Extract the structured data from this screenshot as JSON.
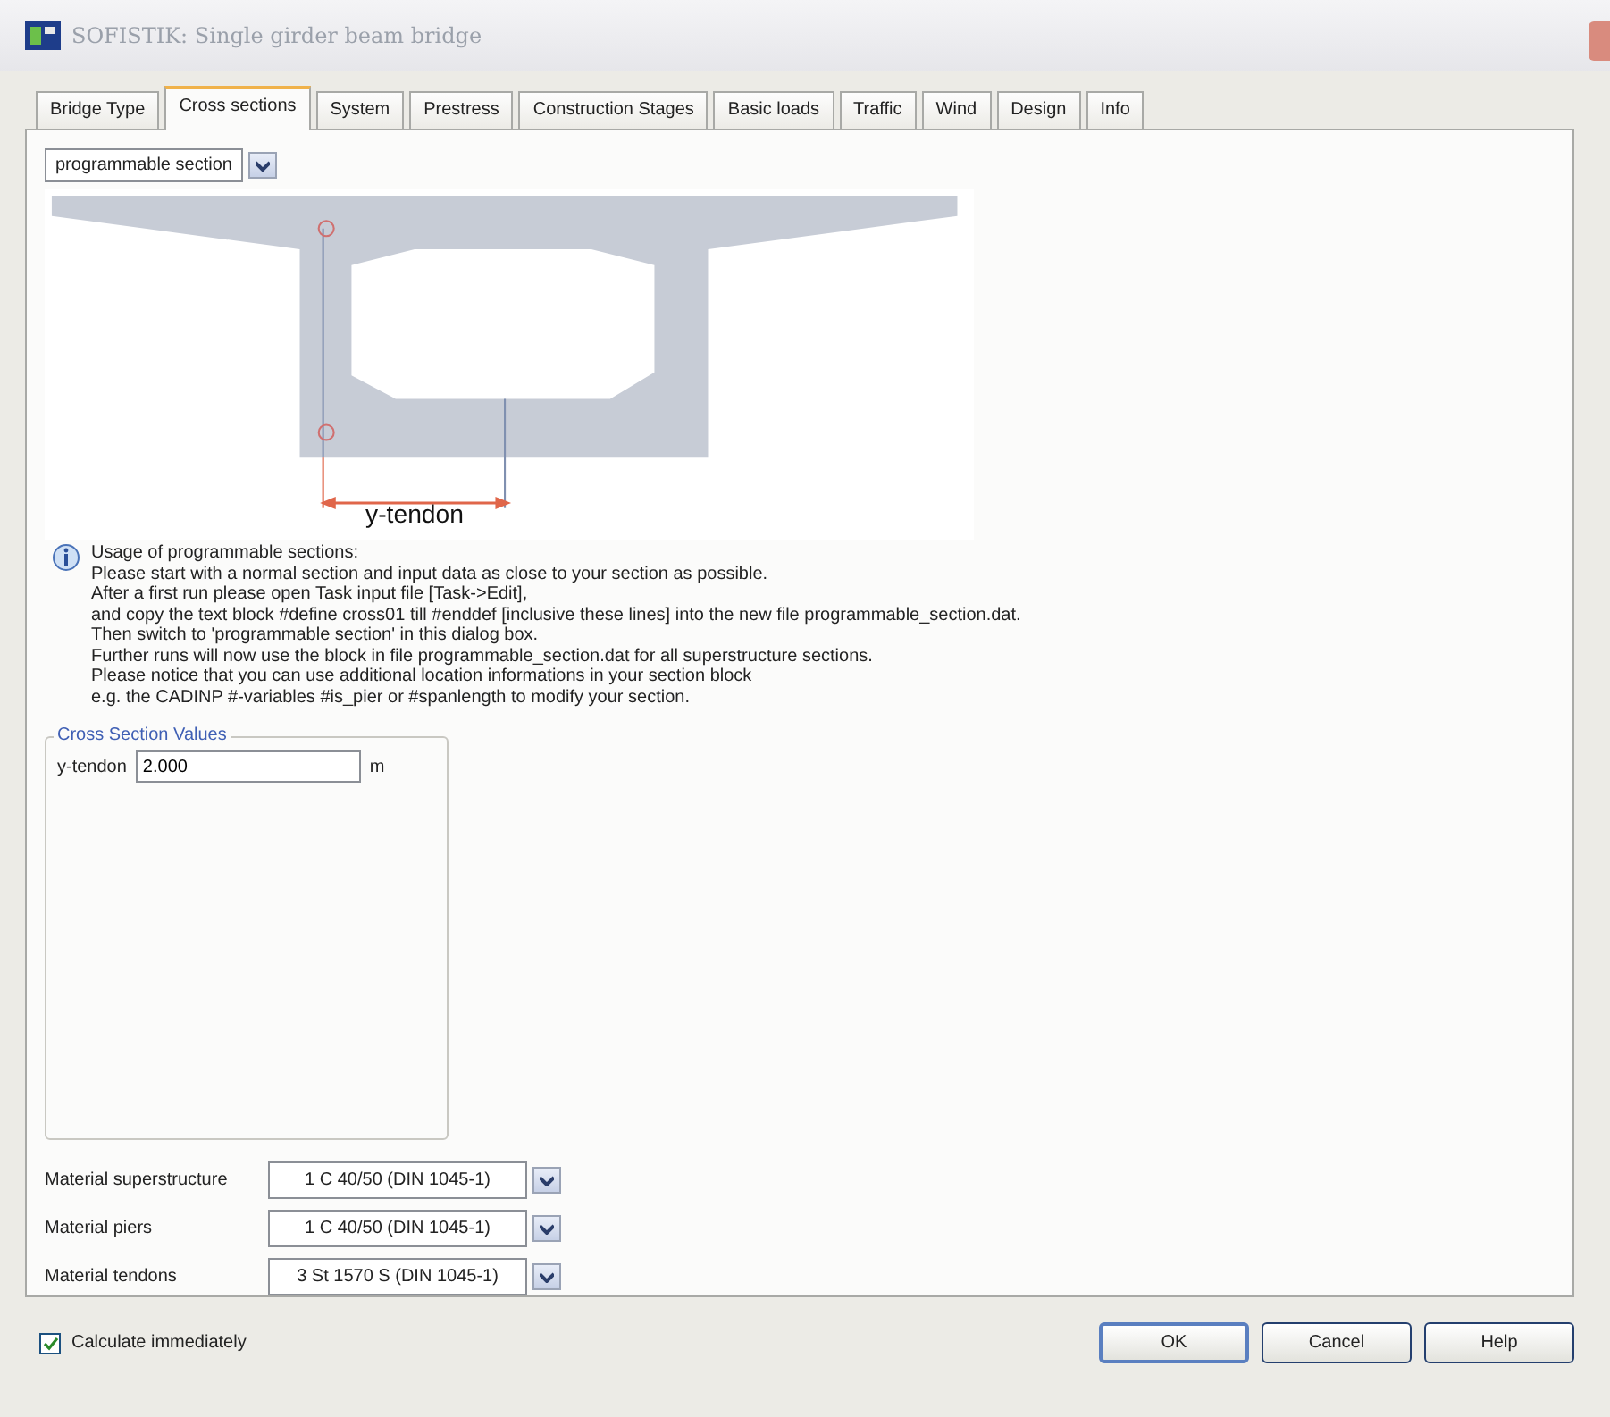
{
  "window": {
    "title": "SOFISTIK: Single girder beam bridge"
  },
  "tabs": [
    {
      "label": "Bridge Type",
      "selected": false
    },
    {
      "label": "Cross sections",
      "selected": true
    },
    {
      "label": "System",
      "selected": false
    },
    {
      "label": "Prestress",
      "selected": false
    },
    {
      "label": "Construction Stages",
      "selected": false
    },
    {
      "label": "Basic loads",
      "selected": false
    },
    {
      "label": "Traffic",
      "selected": false
    },
    {
      "label": "Wind",
      "selected": false
    },
    {
      "label": "Design",
      "selected": false
    },
    {
      "label": "Info",
      "selected": false
    }
  ],
  "section_type": {
    "value": "programmable section"
  },
  "drawing": {
    "dimension_label": "y-tendon"
  },
  "info": {
    "heading": "Usage of programmable sections:",
    "lines": [
      "Please start with a normal section and input data as close to your section as possible.",
      "After a first run please open Task input file [Task->Edit],",
      "and copy the text block #define cross01 till #enddef [inclusive these lines] into the new file programmable_section.dat.",
      "Then switch to 'programmable section' in this dialog box.",
      "Further runs will now use the block in file programmable_section.dat for all superstructure sections.",
      "Please notice that you can use additional location informations in your section block",
      "e.g. the CADINP #-variables #is_pier or #spanlength to modify your section."
    ]
  },
  "cross_section_values": {
    "legend": "Cross Section Values",
    "fields": [
      {
        "label": "y-tendon",
        "value": "2.000",
        "unit": "m"
      }
    ]
  },
  "materials": [
    {
      "label": "Material superstructure",
      "value": "1 C 40/50 (DIN 1045-1)"
    },
    {
      "label": "Material piers",
      "value": "1 C 40/50 (DIN 1045-1)"
    },
    {
      "label": "Material tendons",
      "value": "3 St 1570 S (DIN 1045-1)"
    }
  ],
  "calculate_immediately": {
    "label": "Calculate immediately",
    "checked": true
  },
  "buttons": [
    "OK",
    "Cancel",
    "Help"
  ]
}
